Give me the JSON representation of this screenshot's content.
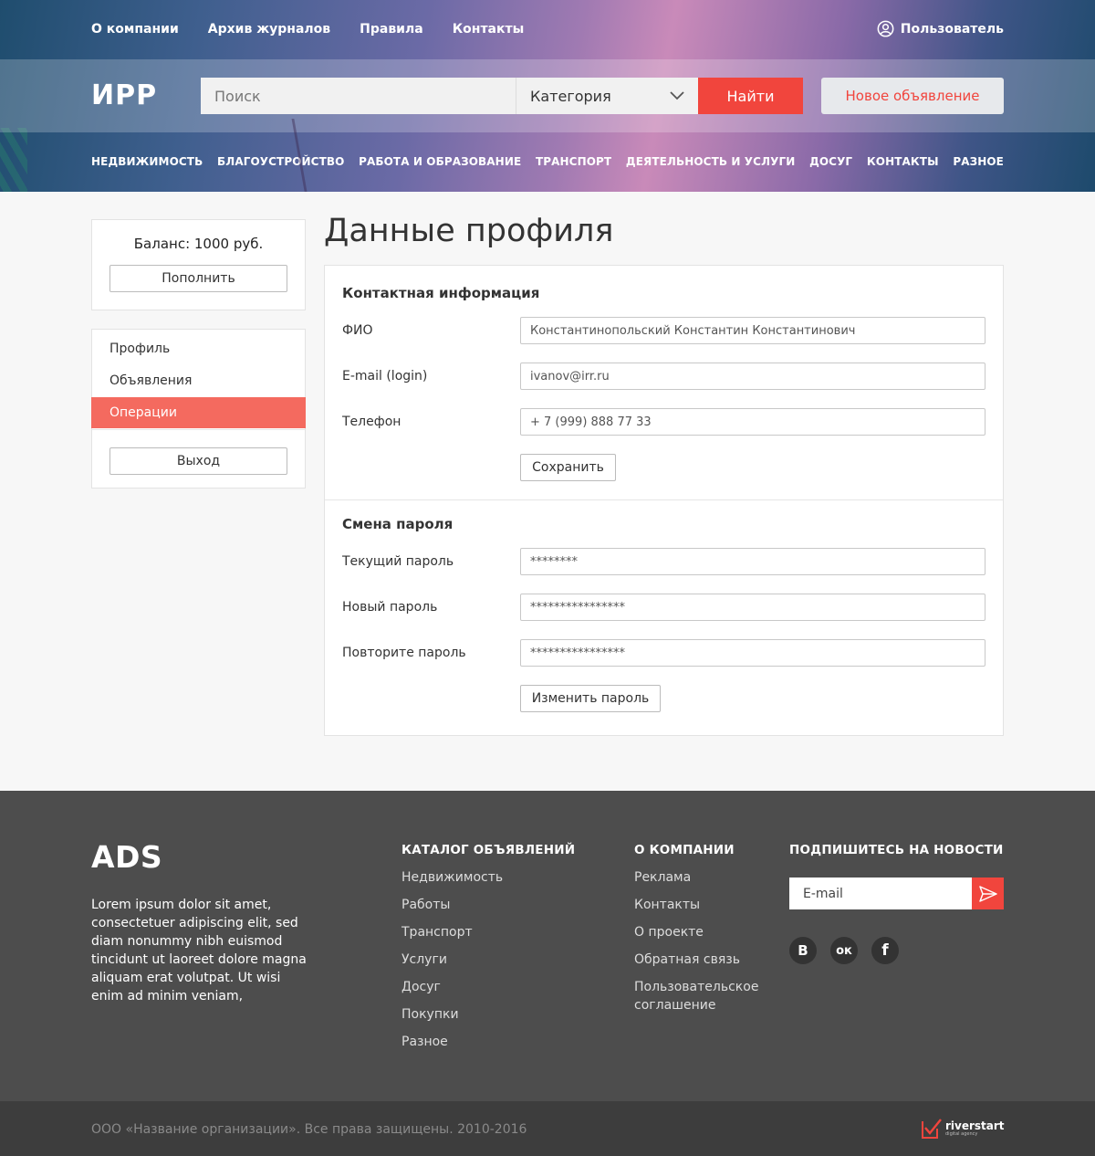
{
  "header": {
    "top_nav": [
      "О компании",
      "Архив журналов",
      "Правила",
      "Контакты"
    ],
    "user_label": "Пользователь",
    "logo": "ИРР",
    "search_placeholder": "Поиск",
    "category_label": "Категория",
    "find_label": "Найти",
    "new_ad_label": "Новое объявление",
    "categories": [
      "НЕДВИЖИМОСТЬ",
      "БЛАГОУСТРОЙСТВО",
      "РАБОТА И ОБРАЗОВАНИЕ",
      "ТРАНСПОРТ",
      "ДЕЯТЕЛЬНОСТЬ И УСЛУГИ",
      "ДОСУГ",
      "КОНТАКТЫ",
      "РАЗНОЕ"
    ]
  },
  "sidebar": {
    "balance_text": "Баланс: 1000 руб.",
    "topup_label": "Пополнить",
    "menu": [
      "Профиль",
      "Объявления",
      "Операции"
    ],
    "active_item": "Операции",
    "logout_label": "Выход"
  },
  "main": {
    "title": "Данные профиля",
    "contact": {
      "title": "Контактная информация",
      "fio_label": "ФИО",
      "fio_value": "Константинопольский Константин Константинович",
      "email_label": "E-mail (login)",
      "email_value": "ivanov@irr.ru",
      "phone_label": "Телефон",
      "phone_value": "+ 7 (999) 888 77 33",
      "save_label": "Сохранить"
    },
    "password": {
      "title": "Смена пароля",
      "current_label": "Текущий пароль",
      "current_value": "********",
      "new_label": "Новый пароль",
      "new_value": "****************",
      "repeat_label": "Повторите пароль",
      "repeat_value": "****************",
      "change_label": "Изменить пароль"
    }
  },
  "footer": {
    "logo": "ADS",
    "description": "Lorem ipsum dolor sit amet, consectetuer adipiscing elit, sed diam nonummy nibh euismod tincidunt ut laoreet dolore magna aliquam erat volutpat. Ut wisi enim ad minim veniam,",
    "catalog_title": "КАТАЛОГ ОБЪЯВЛЕНИЙ",
    "catalog_items": [
      "Недвижимость",
      "Работы",
      "Транспорт",
      "Услуги",
      "Досуг",
      "Покупки",
      "Разное"
    ],
    "company_title": "О  КОМПАНИИ",
    "company_items": [
      "Реклама",
      "Контакты",
      "О проекте",
      "Обратная связь",
      "Пользовательское соглашение"
    ],
    "subscribe_title": "ПОДПИШИТЕСЬ НА НОВОСТИ",
    "email_placeholder": "E-mail",
    "social": [
      "В",
      "ок",
      "f"
    ],
    "copyright": "ООО «Название организации». Все права защищены. 2010-2016",
    "agency_name": "riverstart",
    "agency_sub": "digital agency"
  },
  "colors": {
    "accent": "#f1453d",
    "active_menu": "#f46a5f",
    "footer_bg": "#4d4d4d",
    "bottom_bar_bg": "#3d3d3d"
  },
  "icons": [
    "user-icon",
    "chevron-down-icon",
    "send-icon",
    "vk-icon",
    "odnoklassniki-icon",
    "facebook-icon",
    "riverstart-logo-icon"
  ]
}
